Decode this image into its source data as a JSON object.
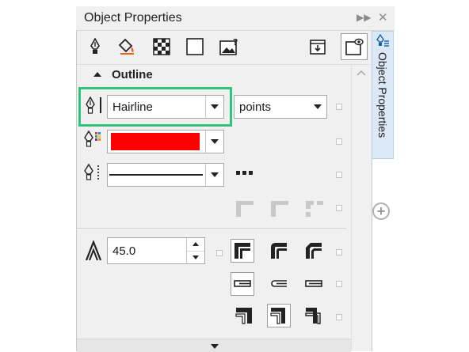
{
  "panel": {
    "title": "Object Properties",
    "side_tab_label": "Object Properties"
  },
  "toolbar": {
    "tools": [
      "outline-pen-icon",
      "fill-bucket-icon",
      "transparency-checker-icon",
      "frame-icon",
      "image-question-icon",
      "stack-down-icon",
      "eye-frame-icon"
    ]
  },
  "outline": {
    "section_label": "Outline",
    "width_value": "Hairline",
    "units_value": "points",
    "color": "#ff0000",
    "miter_value": "45.0"
  },
  "colors": {
    "accent_highlight": "#2ec47c",
    "side_tab_bg": "#dbe9f7"
  }
}
